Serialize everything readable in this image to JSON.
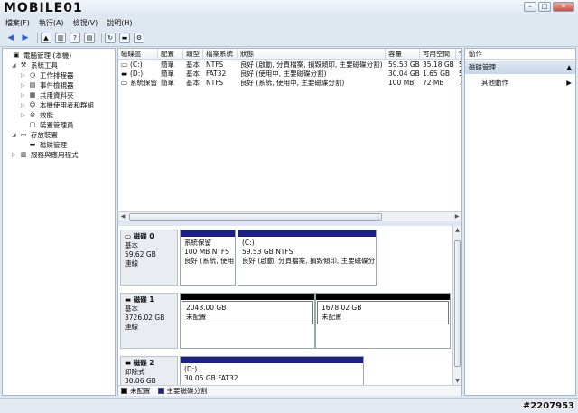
{
  "logo_text": "MOBILE01",
  "menu": [
    "檔案(F)",
    "執行(A)",
    "檢視(V)",
    "說明(H)"
  ],
  "tree": [
    {
      "label": "電腦管理 (本機)",
      "indent": 0,
      "twisty": "",
      "icon": "computer-icon",
      "glyph": "▣"
    },
    {
      "label": "系統工具",
      "indent": 1,
      "twisty": "◢",
      "icon": "tools-icon",
      "glyph": "⚒"
    },
    {
      "label": "工作排程器",
      "indent": 2,
      "twisty": "▷",
      "icon": "scheduler-icon",
      "glyph": "◷"
    },
    {
      "label": "事件檢視器",
      "indent": 2,
      "twisty": "▷",
      "icon": "event-viewer-icon",
      "glyph": "▤"
    },
    {
      "label": "共用資料夾",
      "indent": 2,
      "twisty": "▷",
      "icon": "shared-folder-icon",
      "glyph": "▦"
    },
    {
      "label": "本機使用者和群組",
      "indent": 2,
      "twisty": "▷",
      "icon": "users-icon",
      "glyph": "☺"
    },
    {
      "label": "效能",
      "indent": 2,
      "twisty": "▷",
      "icon": "performance-icon",
      "glyph": "⊘"
    },
    {
      "label": "裝置管理員",
      "indent": 2,
      "twisty": "",
      "icon": "device-manager-icon",
      "glyph": "▢"
    },
    {
      "label": "存放裝置",
      "indent": 1,
      "twisty": "◢",
      "icon": "storage-icon",
      "glyph": "▭"
    },
    {
      "label": "磁碟管理",
      "indent": 2,
      "twisty": "",
      "icon": "disk-management-icon",
      "glyph": "▬"
    },
    {
      "label": "服務與應用程式",
      "indent": 1,
      "twisty": "▷",
      "icon": "services-icon",
      "glyph": "▥"
    }
  ],
  "volume_table": {
    "headers": [
      "磁碟區",
      "配置",
      "類型",
      "檔案系統",
      "狀態",
      "容量",
      "可用空間",
      "%"
    ],
    "rows": [
      [
        "(C:)",
        "簡單",
        "基本",
        "NTFS",
        "良好 (啟動, 分頁檔案, 損毀傾印, 主要磁碟分割)",
        "59.53 GB",
        "35.18 GB",
        "5"
      ],
      [
        "(D:)",
        "簡單",
        "基本",
        "FAT32",
        "良好 (使用中, 主要磁碟分割)",
        "30.04 GB",
        "1.65 GB",
        "5"
      ],
      [
        "系統保留",
        "簡單",
        "基本",
        "NTFS",
        "良好 (系統, 使用中, 主要磁碟分割)",
        "100 MB",
        "72 MB",
        "7"
      ]
    ]
  },
  "disks": [
    {
      "name": "磁碟 0",
      "type": "基本",
      "size": "59.62 GB",
      "status": "連線",
      "partitions": [
        {
          "title": "系統保留",
          "line2": "100 MB NTFS",
          "line3": "良好 (系統, 使用",
          "bar": "primary"
        },
        {
          "title": "(C:)",
          "line2": "59.53 GB NTFS",
          "line3": "良好 (啟動, 分頁檔案, 損毀傾印, 主要磁碟分",
          "bar": "primary"
        }
      ]
    },
    {
      "name": "磁碟 1",
      "type": "基本",
      "size": "3726.02 GB",
      "status": "連線",
      "partitions": [
        {
          "title": "",
          "line2": "2048.00 GB",
          "line3": "未配置",
          "bar": "unallocated"
        },
        {
          "title": "",
          "line2": "1678.02 GB",
          "line3": "未配置",
          "bar": "unallocated"
        }
      ]
    },
    {
      "name": "磁碟 2",
      "type": "卸除式",
      "size": "30.06 GB",
      "status": "",
      "partitions": [
        {
          "title": "(D:)",
          "line2": "30.05 GB FAT32",
          "line3": "",
          "bar": "primary"
        }
      ]
    }
  ],
  "legend": [
    {
      "label": "未配置",
      "color": "#000000"
    },
    {
      "label": "主要磁碟分割",
      "color": "#1b1f86"
    }
  ],
  "actions": {
    "header": "動作",
    "section": "磁碟管理",
    "item": "其他動作"
  },
  "watermark": "#2207953"
}
